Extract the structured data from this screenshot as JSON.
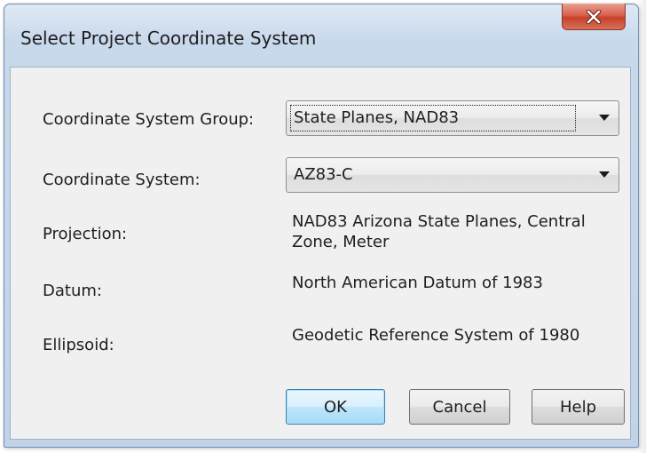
{
  "window": {
    "title": "Select Project Coordinate System",
    "close_icon": "close-icon"
  },
  "form": {
    "group_label": "Coordinate System Group:",
    "group_value": "State Planes, NAD83",
    "system_label": "Coordinate System:",
    "system_value": "AZ83-C",
    "projection_label": "Projection:",
    "projection_line1": "NAD83 Arizona State Planes, Central",
    "projection_line2": "Zone, Meter",
    "datum_label": "Datum:",
    "datum_value": "North American Datum of 1983",
    "ellipsoid_label": "Ellipsoid:",
    "ellipsoid_value": "Geodetic Reference System of 1980"
  },
  "buttons": {
    "ok": "OK",
    "cancel": "Cancel",
    "help": "Help"
  },
  "colors": {
    "close_button": "#c74028",
    "default_button_border": "#3c7fb1",
    "window_frame": "#c2d3e8",
    "client_background": "#f0f0f0"
  }
}
